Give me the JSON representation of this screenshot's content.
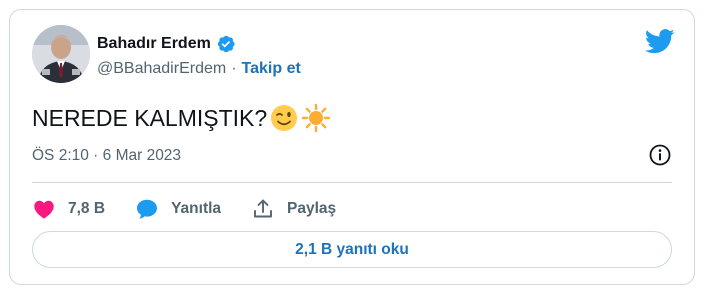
{
  "author": {
    "name": "Bahadır Erdem",
    "handle": "@BBahadirErdem",
    "separator": "·",
    "follow_label": "Takip et"
  },
  "tweet": {
    "text": "NEREDE KALMIŞTIK?",
    "emojis": [
      "winking-face",
      "sun"
    ],
    "timestamp": "ÖS 2:10 · 6 Mar 2023"
  },
  "actions": {
    "like_count": "7,8 B",
    "reply_label": "Yanıtla",
    "share_label": "Paylaş"
  },
  "read_replies_label": "2,1 B yanıtı oku",
  "colors": {
    "accent": "#1d9bf0",
    "link": "#1d72b8",
    "like": "#f91880",
    "muted": "#536471",
    "border": "#cfd9de"
  }
}
